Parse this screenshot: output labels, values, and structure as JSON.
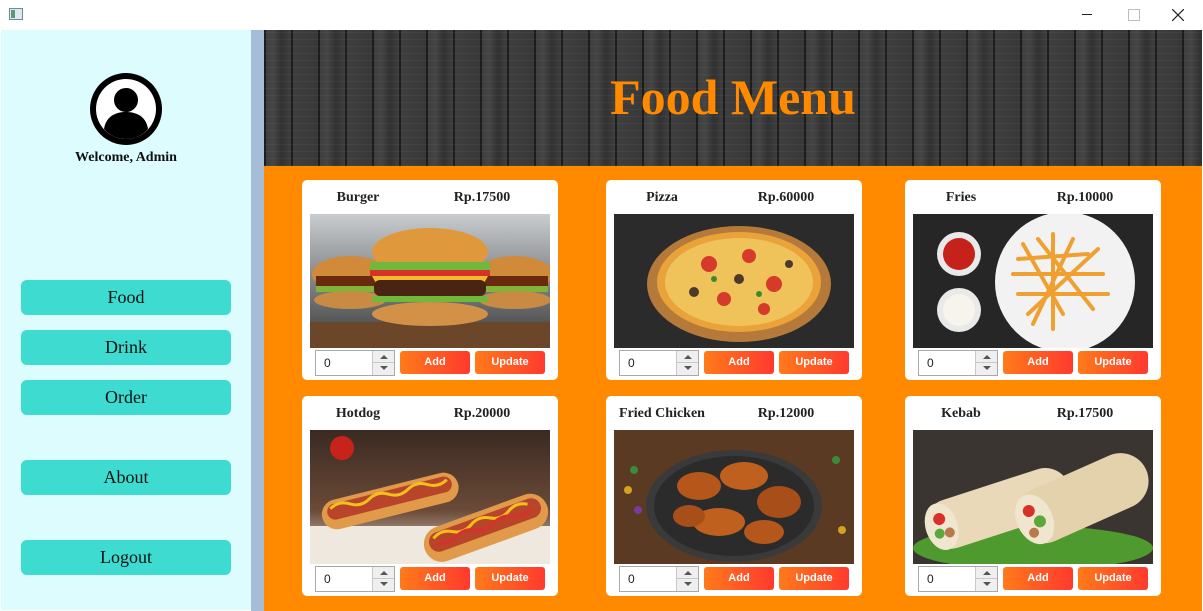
{
  "window": {
    "icons": {
      "app": "app-window-icon",
      "minimize": "minimize-icon",
      "maximize": "maximize-icon",
      "close": "close-icon"
    }
  },
  "sidebar": {
    "avatar_icon": "user-avatar-icon",
    "welcome": "Welcome, Admin",
    "nav": [
      {
        "label": "Food"
      },
      {
        "label": "Drink"
      },
      {
        "label": "Order"
      },
      {
        "label": "About"
      },
      {
        "label": "Logout"
      }
    ],
    "color": "#dcfcfd",
    "button_color": "#3ddbd0"
  },
  "header": {
    "title": "Food Menu",
    "title_color": "#ff8a00"
  },
  "content": {
    "background": "#ff8a00"
  },
  "items": [
    {
      "name": "Burger",
      "price": "Rp.17500",
      "quantity": "0",
      "add_label": "Add",
      "update_label": "Update",
      "image": "burger-photo"
    },
    {
      "name": "Pizza",
      "price": "Rp.60000",
      "quantity": "0",
      "add_label": "Add",
      "update_label": "Update",
      "image": "pizza-photo"
    },
    {
      "name": "Fries",
      "price": "Rp.10000",
      "quantity": "0",
      "add_label": "Add",
      "update_label": "Update",
      "image": "fries-photo"
    },
    {
      "name": "Hotdog",
      "price": "Rp.20000",
      "quantity": "0",
      "add_label": "Add",
      "update_label": "Update",
      "image": "hotdog-photo"
    },
    {
      "name": "Fried Chicken",
      "price": "Rp.12000",
      "quantity": "0",
      "add_label": "Add",
      "update_label": "Update",
      "image": "fried-chicken-photo"
    },
    {
      "name": "Kebab",
      "price": "Rp.17500",
      "quantity": "0",
      "add_label": "Add",
      "update_label": "Update",
      "image": "kebab-photo"
    }
  ]
}
